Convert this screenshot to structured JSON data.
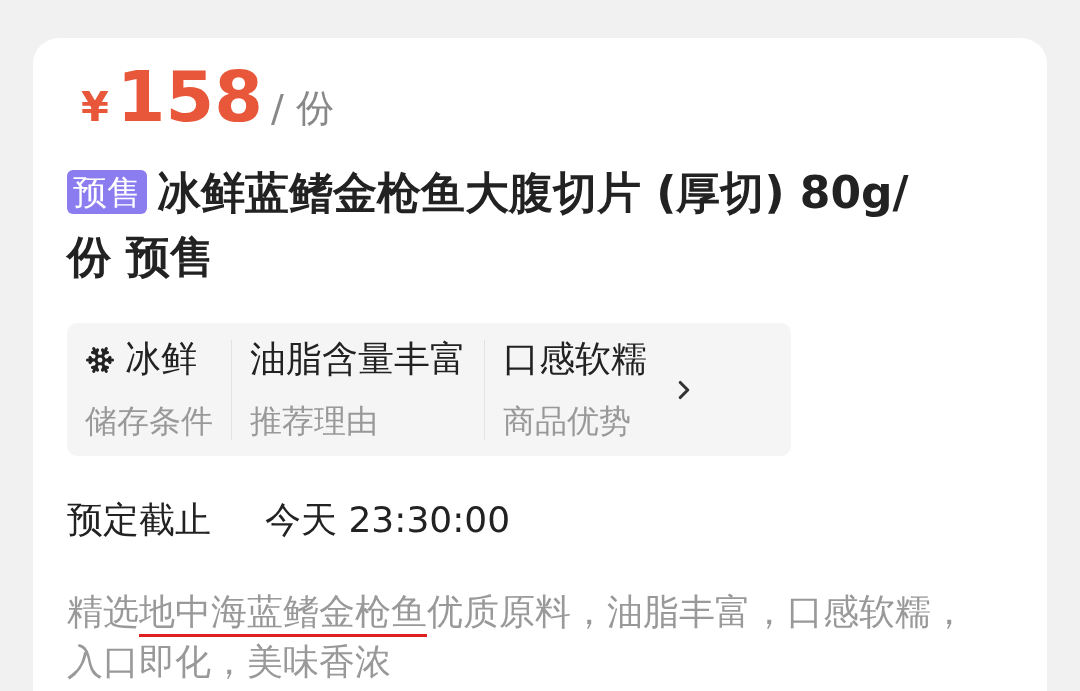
{
  "price": {
    "currency": "¥",
    "amount": "158",
    "unit": "/ 份"
  },
  "product": {
    "badge": "预售",
    "title": "冰鲜蓝鳍金枪鱼大腹切片 (厚切) 80g/份 预售"
  },
  "attributes": [
    {
      "kind": "icon",
      "value": "冰鲜",
      "label": "储存条件"
    },
    {
      "kind": "plain",
      "value": "油脂含量丰富",
      "label": "推荐理由"
    },
    {
      "kind": "plain",
      "value": "口感软糯",
      "label": "商品优势"
    }
  ],
  "deadline": {
    "label": "预定截止",
    "value": "今天 23:30:00"
  },
  "description": {
    "before": "精选",
    "underlined": "地中海蓝鳍金枪鱼",
    "after": "优质原料，油脂丰富，口感软糯，入口即化，美味香浓"
  }
}
